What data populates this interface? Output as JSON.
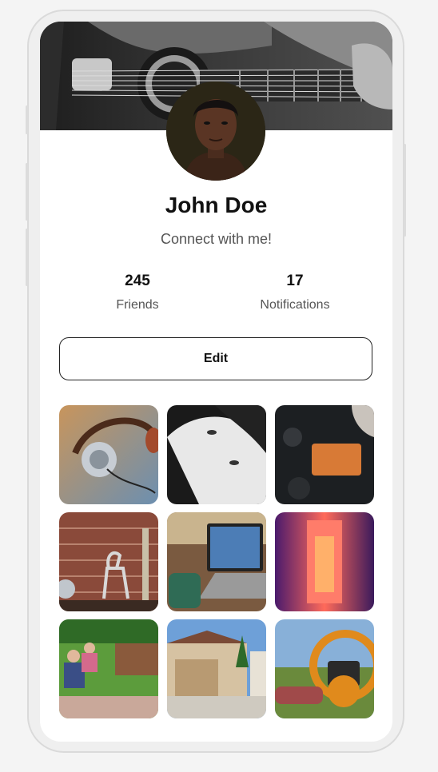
{
  "profile": {
    "name": "John Doe",
    "tagline": "Connect with me!",
    "cover_alt": "guitar-cover-photo",
    "avatar_alt": "profile-avatar"
  },
  "stats": [
    {
      "value": "245",
      "label": "Friends"
    },
    {
      "value": "17",
      "label": "Notifications"
    }
  ],
  "actions": {
    "edit_label": "Edit"
  },
  "gallery": [
    {
      "subject": "headphones"
    },
    {
      "subject": "portrait-bw"
    },
    {
      "subject": "camera-controls"
    },
    {
      "subject": "deer-figurine"
    },
    {
      "subject": "laptop-video-call"
    },
    {
      "subject": "neon-corridor"
    },
    {
      "subject": "elderly-couple-garden"
    },
    {
      "subject": "house-garage"
    },
    {
      "subject": "camera-gear-field"
    }
  ]
}
